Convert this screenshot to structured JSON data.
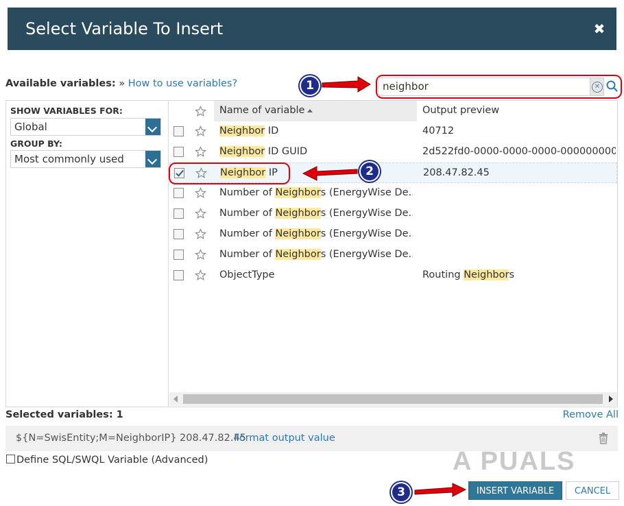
{
  "dialog": {
    "title": "Select Variable To Insert",
    "close_glyph": "✖"
  },
  "available": {
    "label": "Available variables:",
    "separator": "»",
    "help_link": "How to use variables?"
  },
  "search": {
    "value": "neighbor"
  },
  "sidebar": {
    "show_for_label": "SHOW VARIABLES FOR:",
    "show_for_value": "Global",
    "group_by_label": "GROUP BY:",
    "group_by_value": "Most commonly used"
  },
  "grid": {
    "col_name": "Name of variable",
    "col_output": "Output preview",
    "rows": [
      {
        "hl": "Neighbor",
        "name_rest": " ID",
        "out_pre": "40712",
        "out_hl": "",
        "out_post": "",
        "checked": false
      },
      {
        "hl": "Neighbor",
        "name_rest": " ID GUID",
        "out_pre": "2d522fd0-0000-0000-0000-000000000...",
        "out_hl": "",
        "out_post": "",
        "checked": false
      },
      {
        "hl": "Neighbor",
        "name_rest": " IP",
        "out_pre": "208.47.82.45",
        "out_hl": "",
        "out_post": "",
        "checked": true
      },
      {
        "pre": "Number of ",
        "hl": "Neighbor",
        "name_rest": "s (EnergyWise De...",
        "out_pre": "",
        "out_hl": "",
        "out_post": "",
        "checked": false
      },
      {
        "pre": "Number of ",
        "hl": "Neighbor",
        "name_rest": "s (EnergyWise De...",
        "out_pre": "",
        "out_hl": "",
        "out_post": "",
        "checked": false
      },
      {
        "pre": "Number of ",
        "hl": "Neighbor",
        "name_rest": "s (EnergyWise De...",
        "out_pre": "",
        "out_hl": "",
        "out_post": "",
        "checked": false
      },
      {
        "pre": "Number of ",
        "hl": "Neighbor",
        "name_rest": "s (EnergyWise De...",
        "out_pre": "",
        "out_hl": "",
        "out_post": "",
        "checked": false
      },
      {
        "pre": "ObjectType",
        "hl": "",
        "name_rest": "",
        "out_pre": "Routing ",
        "out_hl": "Neighbor",
        "out_post": "s",
        "checked": false
      }
    ]
  },
  "selected": {
    "count_label": "Selected variables: 1",
    "remove_all": "Remove All",
    "item_code": "${N=SwisEntity;M=NeighborIP} 208.47.82.45",
    "format_link": "Format output value"
  },
  "define_sql": "Define SQL/SWQL Variable (Advanced)",
  "watermark": "A  PUALS",
  "buttons": {
    "insert": "INSERT VARIABLE",
    "cancel": "CANCEL"
  },
  "annotations": [
    "1",
    "2",
    "3"
  ],
  "colors": {
    "titlebar": "#2a4a5e",
    "accent": "#2e7799",
    "highlight": "#fde99b",
    "annotation_red": "#e0000a",
    "annotation_blue": "#1e2d8c"
  }
}
